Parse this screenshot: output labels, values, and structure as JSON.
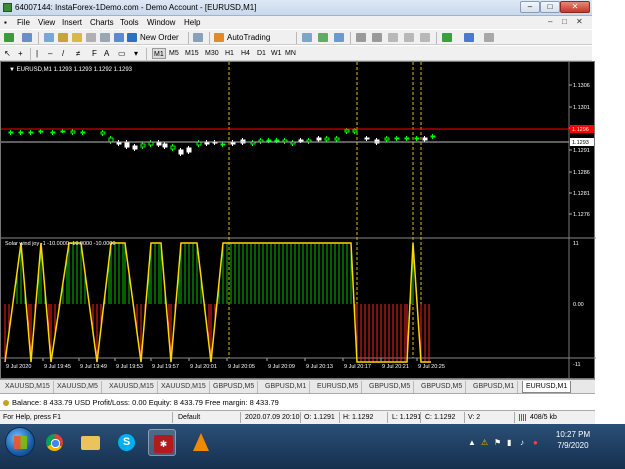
{
  "window": {
    "title": "64007144: InstaForex-1Demo.com - Demo Account - [EURUSD,M1]",
    "min": "–",
    "max": "□",
    "close": "✕"
  },
  "menu": [
    "File",
    "View",
    "Insert",
    "Charts",
    "Tools",
    "Window",
    "Help"
  ],
  "menu_controls": [
    "–",
    "□",
    "✕"
  ],
  "toolbar": {
    "new_order": "New Order",
    "autotrading": "AutoTrading",
    "timeframes": [
      "M1",
      "M5",
      "M15",
      "M30",
      "H1",
      "H4",
      "D1",
      "W1",
      "MN"
    ],
    "active_timeframe": "M1"
  },
  "chart": {
    "symbol_info": "EURUSD,M1  1.1293 1.1293 1.1292 1.1293",
    "price_labels": [
      "1.1306",
      "1.1301",
      "1.1296",
      "1.1291",
      "1.1286",
      "1.1281",
      "1.1276"
    ],
    "current_price": "1.1293",
    "red_line_price": "1.1296",
    "indicator_label": "Solar wind joy -1 -10.0000 -10.0000 -10.0000",
    "indicator_levels": [
      "11",
      "0.00",
      "-11"
    ],
    "time_labels": [
      "9 Jul 2020",
      "9 Jul 19:45",
      "9 Jul 19:49",
      "9 Jul 19:53",
      "9 Jul 19:57",
      "9 Jul 20:01",
      "9 Jul 20:05",
      "9 Jul 20:09",
      "9 Jul 20:13",
      "9 Jul 20:17",
      "9 Jul 20:21",
      "9 Jul 20:25"
    ],
    "colors": {
      "bull": "#00ff00",
      "bear": "#ffffff",
      "up_hist": "#00c000",
      "down_hist": "#ff2020",
      "line": "#ffd800",
      "bid_line": "#ff0000",
      "period_sep": "#d4c000"
    }
  },
  "tabs": [
    "XAUUSD,M15",
    "XAUUSD,M5",
    "XAUUSD,M15",
    "XAUUSD,M15",
    "GBPUSD,M5",
    "GBPUSD,M1",
    "EURUSD,M5",
    "GBPUSD,M5",
    "GBPUSD,M5",
    "GBPUSD,M1",
    "EURUSD,M1"
  ],
  "active_tab": "EURUSD,M1",
  "terminal": {
    "account_line": "Balance: 8 433.79 USD  Profit/Loss: 0.00  Equity: 8 433.79  Free margin: 8 433.79"
  },
  "status": {
    "help": "For Help, press F1",
    "profile": "Default",
    "datetime": "2020.07.09 20:10",
    "open": "O: 1.1291",
    "high": "H: 1.1292",
    "low": "L: 1.1291",
    "close": "C: 1.1292",
    "volume": "V: 2",
    "traffic": "408/5 kb"
  },
  "taskbar": {
    "time": "10:27 PM",
    "date": "7/9/2020"
  },
  "icons": [
    "windows-start-icon",
    "chrome-icon",
    "folder-icon",
    "skype-icon",
    "mt4-icon",
    "vlc-icon"
  ]
}
